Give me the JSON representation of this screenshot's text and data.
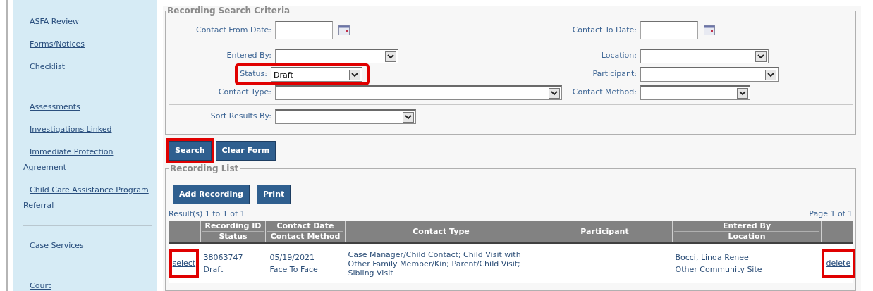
{
  "sidebar": {
    "groups": [
      {
        "items": [
          {
            "label": "ASFA Review"
          },
          {
            "label": "Forms/Notices"
          },
          {
            "label": "Checklist"
          }
        ]
      },
      {
        "items": [
          {
            "label": "Assessments"
          },
          {
            "label": "Investigations Linked"
          },
          {
            "label": "Immediate Protection Agreement"
          },
          {
            "label": "Child Care Assistance Program Referral"
          }
        ]
      },
      {
        "items": [
          {
            "label": "Case Services"
          }
        ]
      },
      {
        "items": [
          {
            "label": "Court"
          }
        ]
      }
    ]
  },
  "search_criteria": {
    "legend": "Recording Search Criteria",
    "sections": [
      {
        "rows": [
          {
            "left": {
              "label": "Contact From Date:",
              "kind": "date",
              "highlighted": false
            },
            "right": {
              "label": "Contact To Date:",
              "kind": "date",
              "highlighted": false
            }
          }
        ]
      },
      {
        "rows": [
          {
            "left": {
              "label": "Entered By:",
              "kind": "select",
              "highlighted": false
            },
            "right": {
              "label": "Location:",
              "kind": "select",
              "highlighted": false
            }
          },
          {
            "left": {
              "label": "Status:",
              "kind": "select",
              "value": "Draft",
              "highlighted": true
            },
            "right": {
              "label": "Participant:",
              "kind": "select",
              "highlighted": false
            }
          },
          {
            "left": {
              "label": "Contact Type:",
              "kind": "select",
              "highlighted": false
            },
            "right": {
              "label": "Contact Method:",
              "kind": "select",
              "highlighted": false
            }
          }
        ]
      },
      {
        "rows": [
          {
            "left": {
              "label": "Sort Results By:",
              "kind": "select",
              "highlighted": false
            }
          }
        ]
      }
    ]
  },
  "form_buttons": [
    {
      "label": "Search",
      "highlighted": true
    },
    {
      "label": "Clear Form",
      "highlighted": false
    }
  ],
  "recording_list": {
    "legend": "Recording List",
    "buttons": [
      {
        "label": "Add Recording"
      },
      {
        "label": "Print"
      }
    ],
    "result_count": "Result(s) 1 to 1 of 1",
    "page": "Page 1 of 1",
    "columns": [
      {},
      {
        "lines": [
          "Recording ID",
          "Status"
        ]
      },
      {
        "lines": [
          "Contact Date",
          "Contact Method"
        ]
      },
      {
        "lines": [
          "Contact Type"
        ]
      },
      {
        "lines": [
          "Participant"
        ]
      },
      {
        "lines": [
          "Entered By",
          "Location"
        ]
      },
      {}
    ],
    "rows": [
      {
        "select": {
          "label": "select",
          "highlighted": true
        },
        "recording_id": [
          "38063747",
          "Draft"
        ],
        "contact": [
          "05/19/2021",
          "Face To Face"
        ],
        "contact_type": "Case Manager/Child Contact; Child Visit with Other Family Member/Kin; Parent/Child Visit; Sibling Visit",
        "entered_by": [
          "Bocci, Linda Renee",
          "Other Community Site"
        ],
        "delete": {
          "label": "delete",
          "highlighted": true
        }
      }
    ]
  }
}
